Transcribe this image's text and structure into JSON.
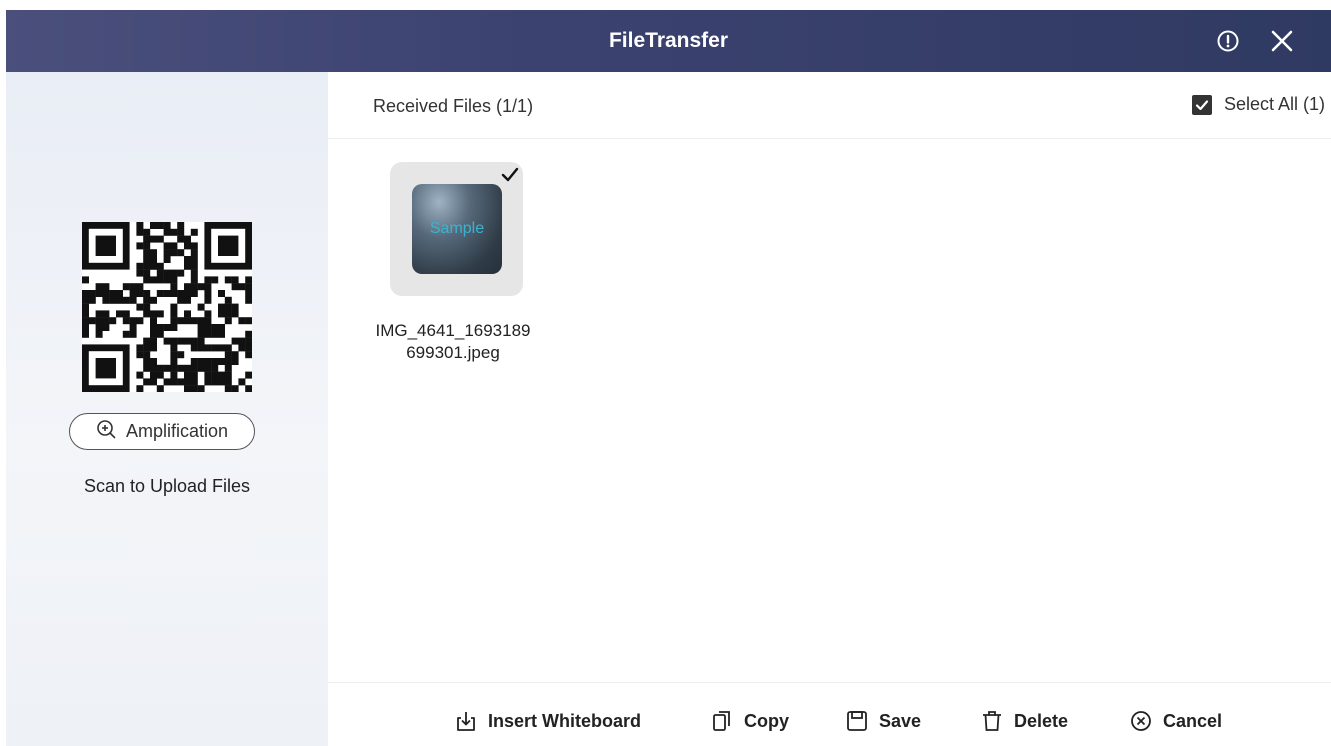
{
  "app": {
    "title": "FileTransfer"
  },
  "colors": {
    "titlebar_start": "#4a4f7c",
    "titlebar_end": "#2f3a62",
    "left_panel_bg": "#eef1f6",
    "sample_text": "#39b4d0"
  },
  "title_actions": [
    {
      "icon": "info-icon"
    },
    {
      "icon": "close-icon"
    }
  ],
  "left_panel": {
    "amplification_label": "Amplification",
    "scan_label": "Scan to Upload Files",
    "qr_icon": "qr-code"
  },
  "main": {
    "received_label": "Received Files (1/1)",
    "select_all_label": "Select All (1)",
    "select_all_checked": true,
    "files": [
      {
        "name": "IMG_4641_1693189699301.jpeg",
        "thumbnail_text": "Sample",
        "selected": true
      }
    ]
  },
  "actions": [
    {
      "label": "Insert Whiteboard",
      "icon": "insert-icon"
    },
    {
      "label": "Copy",
      "icon": "copy-icon"
    },
    {
      "label": "Save",
      "icon": "save-icon"
    },
    {
      "label": "Delete",
      "icon": "trash-icon"
    },
    {
      "label": "Cancel",
      "icon": "cancel-icon"
    }
  ]
}
